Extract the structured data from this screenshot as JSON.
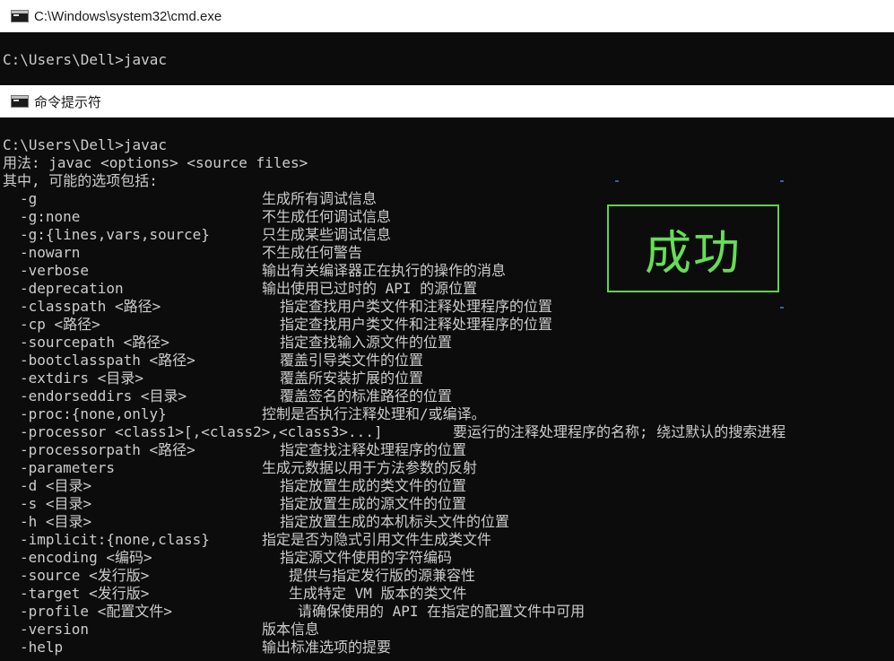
{
  "window1": {
    "title": "C:\\Windows\\system32\\cmd.exe",
    "prompt": "C:\\Users\\Dell>javac"
  },
  "window2": {
    "title": "命令提示符",
    "prompt": "C:\\Users\\Dell>javac",
    "usage": "用法: javac <options> <source files>",
    "intro": "其中, 可能的选项包括:",
    "options": [
      {
        "opt": "-g",
        "desc": "生成所有调试信息"
      },
      {
        "opt": "-g:none",
        "desc": "不生成任何调试信息"
      },
      {
        "opt": "-g:{lines,vars,source}",
        "desc": "只生成某些调试信息"
      },
      {
        "opt": "-nowarn",
        "desc": "不生成任何警告"
      },
      {
        "opt": "-verbose",
        "desc": "输出有关编译器正在执行的操作的消息"
      },
      {
        "opt": "-deprecation",
        "desc": "输出使用已过时的 API 的源位置"
      },
      {
        "opt": "-classpath <路径>",
        "desc": "指定查找用户类文件和注释处理程序的位置"
      },
      {
        "opt": "-cp <路径>",
        "desc": "指定查找用户类文件和注释处理程序的位置"
      },
      {
        "opt": "-sourcepath <路径>",
        "desc": "指定查找输入源文件的位置"
      },
      {
        "opt": "-bootclasspath <路径>",
        "desc": "覆盖引导类文件的位置"
      },
      {
        "opt": "-extdirs <目录>",
        "desc": "覆盖所安装扩展的位置"
      },
      {
        "opt": "-endorseddirs <目录>",
        "desc": "覆盖签名的标准路径的位置"
      },
      {
        "opt": "-proc:{none,only}",
        "desc": "控制是否执行注释处理和/或编译。"
      },
      {
        "opt": "-processor <class1>[,<class2>,<class3>...]",
        "desc": "要运行的注释处理程序的名称; 绕过默认的搜索进程"
      },
      {
        "opt": "-processorpath <路径>",
        "desc": "指定查找注释处理程序的位置"
      },
      {
        "opt": "-parameters",
        "desc": "生成元数据以用于方法参数的反射"
      },
      {
        "opt": "-d <目录>",
        "desc": "指定放置生成的类文件的位置"
      },
      {
        "opt": "-s <目录>",
        "desc": "指定放置生成的源文件的位置"
      },
      {
        "opt": "-h <目录>",
        "desc": "指定放置生成的本机标头文件的位置"
      },
      {
        "opt": "-implicit:{none,class}",
        "desc": "指定是否为隐式引用文件生成类文件"
      },
      {
        "opt": "-encoding <编码>",
        "desc": "指定源文件使用的字符编码"
      },
      {
        "opt": "-source <发行版>",
        "desc": "提供与指定发行版的源兼容性"
      },
      {
        "opt": "-target <发行版>",
        "desc": "生成特定 VM 版本的类文件"
      },
      {
        "opt": "-profile <配置文件>",
        "desc": "请确保使用的 API 在指定的配置文件中可用"
      },
      {
        "opt": "-version",
        "desc": "版本信息"
      },
      {
        "opt": "-help",
        "desc": "输出标准选项的提要"
      }
    ]
  },
  "overlay": {
    "label": "成功",
    "color": "#66dd55"
  },
  "colors": {
    "terminal_bg": "#0c0c0c",
    "terminal_fg": "#cccccc",
    "titlebar_bg": "#ffffff"
  },
  "icons": [
    "cmd-icon"
  ]
}
